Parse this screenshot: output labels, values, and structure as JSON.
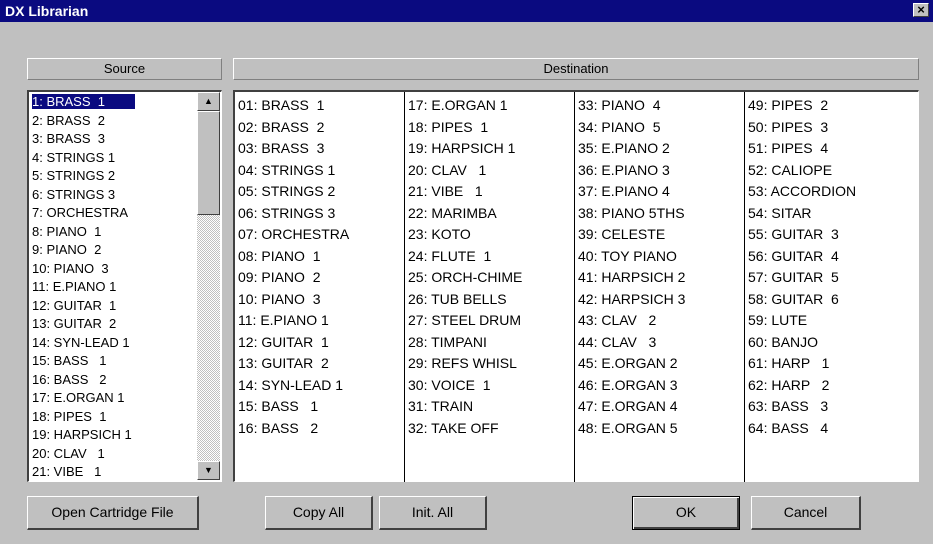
{
  "window": {
    "title": "DX Librarian",
    "close_label": "×"
  },
  "headers": {
    "source": "Source",
    "destination": "Destination"
  },
  "source_list": [
    "1: BRASS  1",
    "2: BRASS  2",
    "3: BRASS  3",
    "4: STRINGS 1",
    "5: STRINGS 2",
    "6: STRINGS 3",
    "7: ORCHESTRA",
    "8: PIANO  1",
    "9: PIANO  2",
    "10: PIANO  3",
    "11: E.PIANO 1",
    "12: GUITAR  1",
    "13: GUITAR  2",
    "14: SYN-LEAD 1",
    "15: BASS   1",
    "16: BASS   2",
    "17: E.ORGAN 1",
    "18: PIPES  1",
    "19: HARPSICH 1",
    "20: CLAV   1",
    "21: VIBE   1"
  ],
  "scrollbar": {
    "up_icon": "▲",
    "down_icon": "▼"
  },
  "destination": [
    [
      "01: BRASS  1",
      "02: BRASS  2",
      "03: BRASS  3",
      "04: STRINGS 1",
      "05: STRINGS 2",
      "06: STRINGS 3",
      "07: ORCHESTRA",
      "08: PIANO  1",
      "09: PIANO  2",
      "10: PIANO  3",
      "11: E.PIANO 1",
      "12: GUITAR  1",
      "13: GUITAR  2",
      "14: SYN-LEAD 1",
      "15: BASS   1",
      "16: BASS   2"
    ],
    [
      "17: E.ORGAN 1",
      "18: PIPES  1",
      "19: HARPSICH 1",
      "20: CLAV   1",
      "21: VIBE   1",
      "22: MARIMBA",
      "23: KOTO",
      "24: FLUTE  1",
      "25: ORCH-CHIME",
      "26: TUB BELLS",
      "27: STEEL DRUM",
      "28: TIMPANI",
      "29: REFS WHISL",
      "30: VOICE  1",
      "31: TRAIN",
      "32: TAKE OFF"
    ],
    [
      "33: PIANO  4",
      "34: PIANO  5",
      "35: E.PIANO 2",
      "36: E.PIANO 3",
      "37: E.PIANO 4",
      "38: PIANO 5THS",
      "39: CELESTE",
      "40: TOY PIANO",
      "41: HARPSICH 2",
      "42: HARPSICH 3",
      "43: CLAV   2",
      "44: CLAV   3",
      "45: E.ORGAN 2",
      "46: E.ORGAN 3",
      "47: E.ORGAN 4",
      "48: E.ORGAN 5"
    ],
    [
      "49: PIPES  2",
      "50: PIPES  3",
      "51: PIPES  4",
      "52: CALIOPE",
      "53: ACCORDION",
      "54: SITAR",
      "55: GUITAR  3",
      "56: GUITAR  4",
      "57: GUITAR  5",
      "58: GUITAR  6",
      "59: LUTE",
      "60: BANJO",
      "61: HARP   1",
      "62: HARP   2",
      "63: BASS   3",
      "64: BASS   4"
    ]
  ],
  "buttons": {
    "open_cartridge": "Open Cartridge File",
    "copy_all": "Copy All",
    "init_all": "Init. All",
    "ok": "OK",
    "cancel": "Cancel"
  }
}
